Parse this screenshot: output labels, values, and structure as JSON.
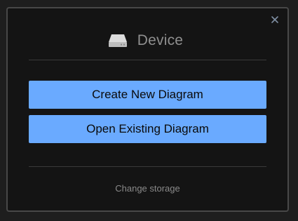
{
  "dialog": {
    "title": "Device",
    "title_icon": "hard-drive-icon",
    "close_icon": "close-icon"
  },
  "actions": {
    "create_label": "Create New Diagram",
    "open_label": "Open Existing Diagram"
  },
  "footer": {
    "change_storage_label": "Change storage"
  },
  "colors": {
    "button_bg": "#6aaaff",
    "dialog_bg": "#141414",
    "border": "#484848"
  }
}
